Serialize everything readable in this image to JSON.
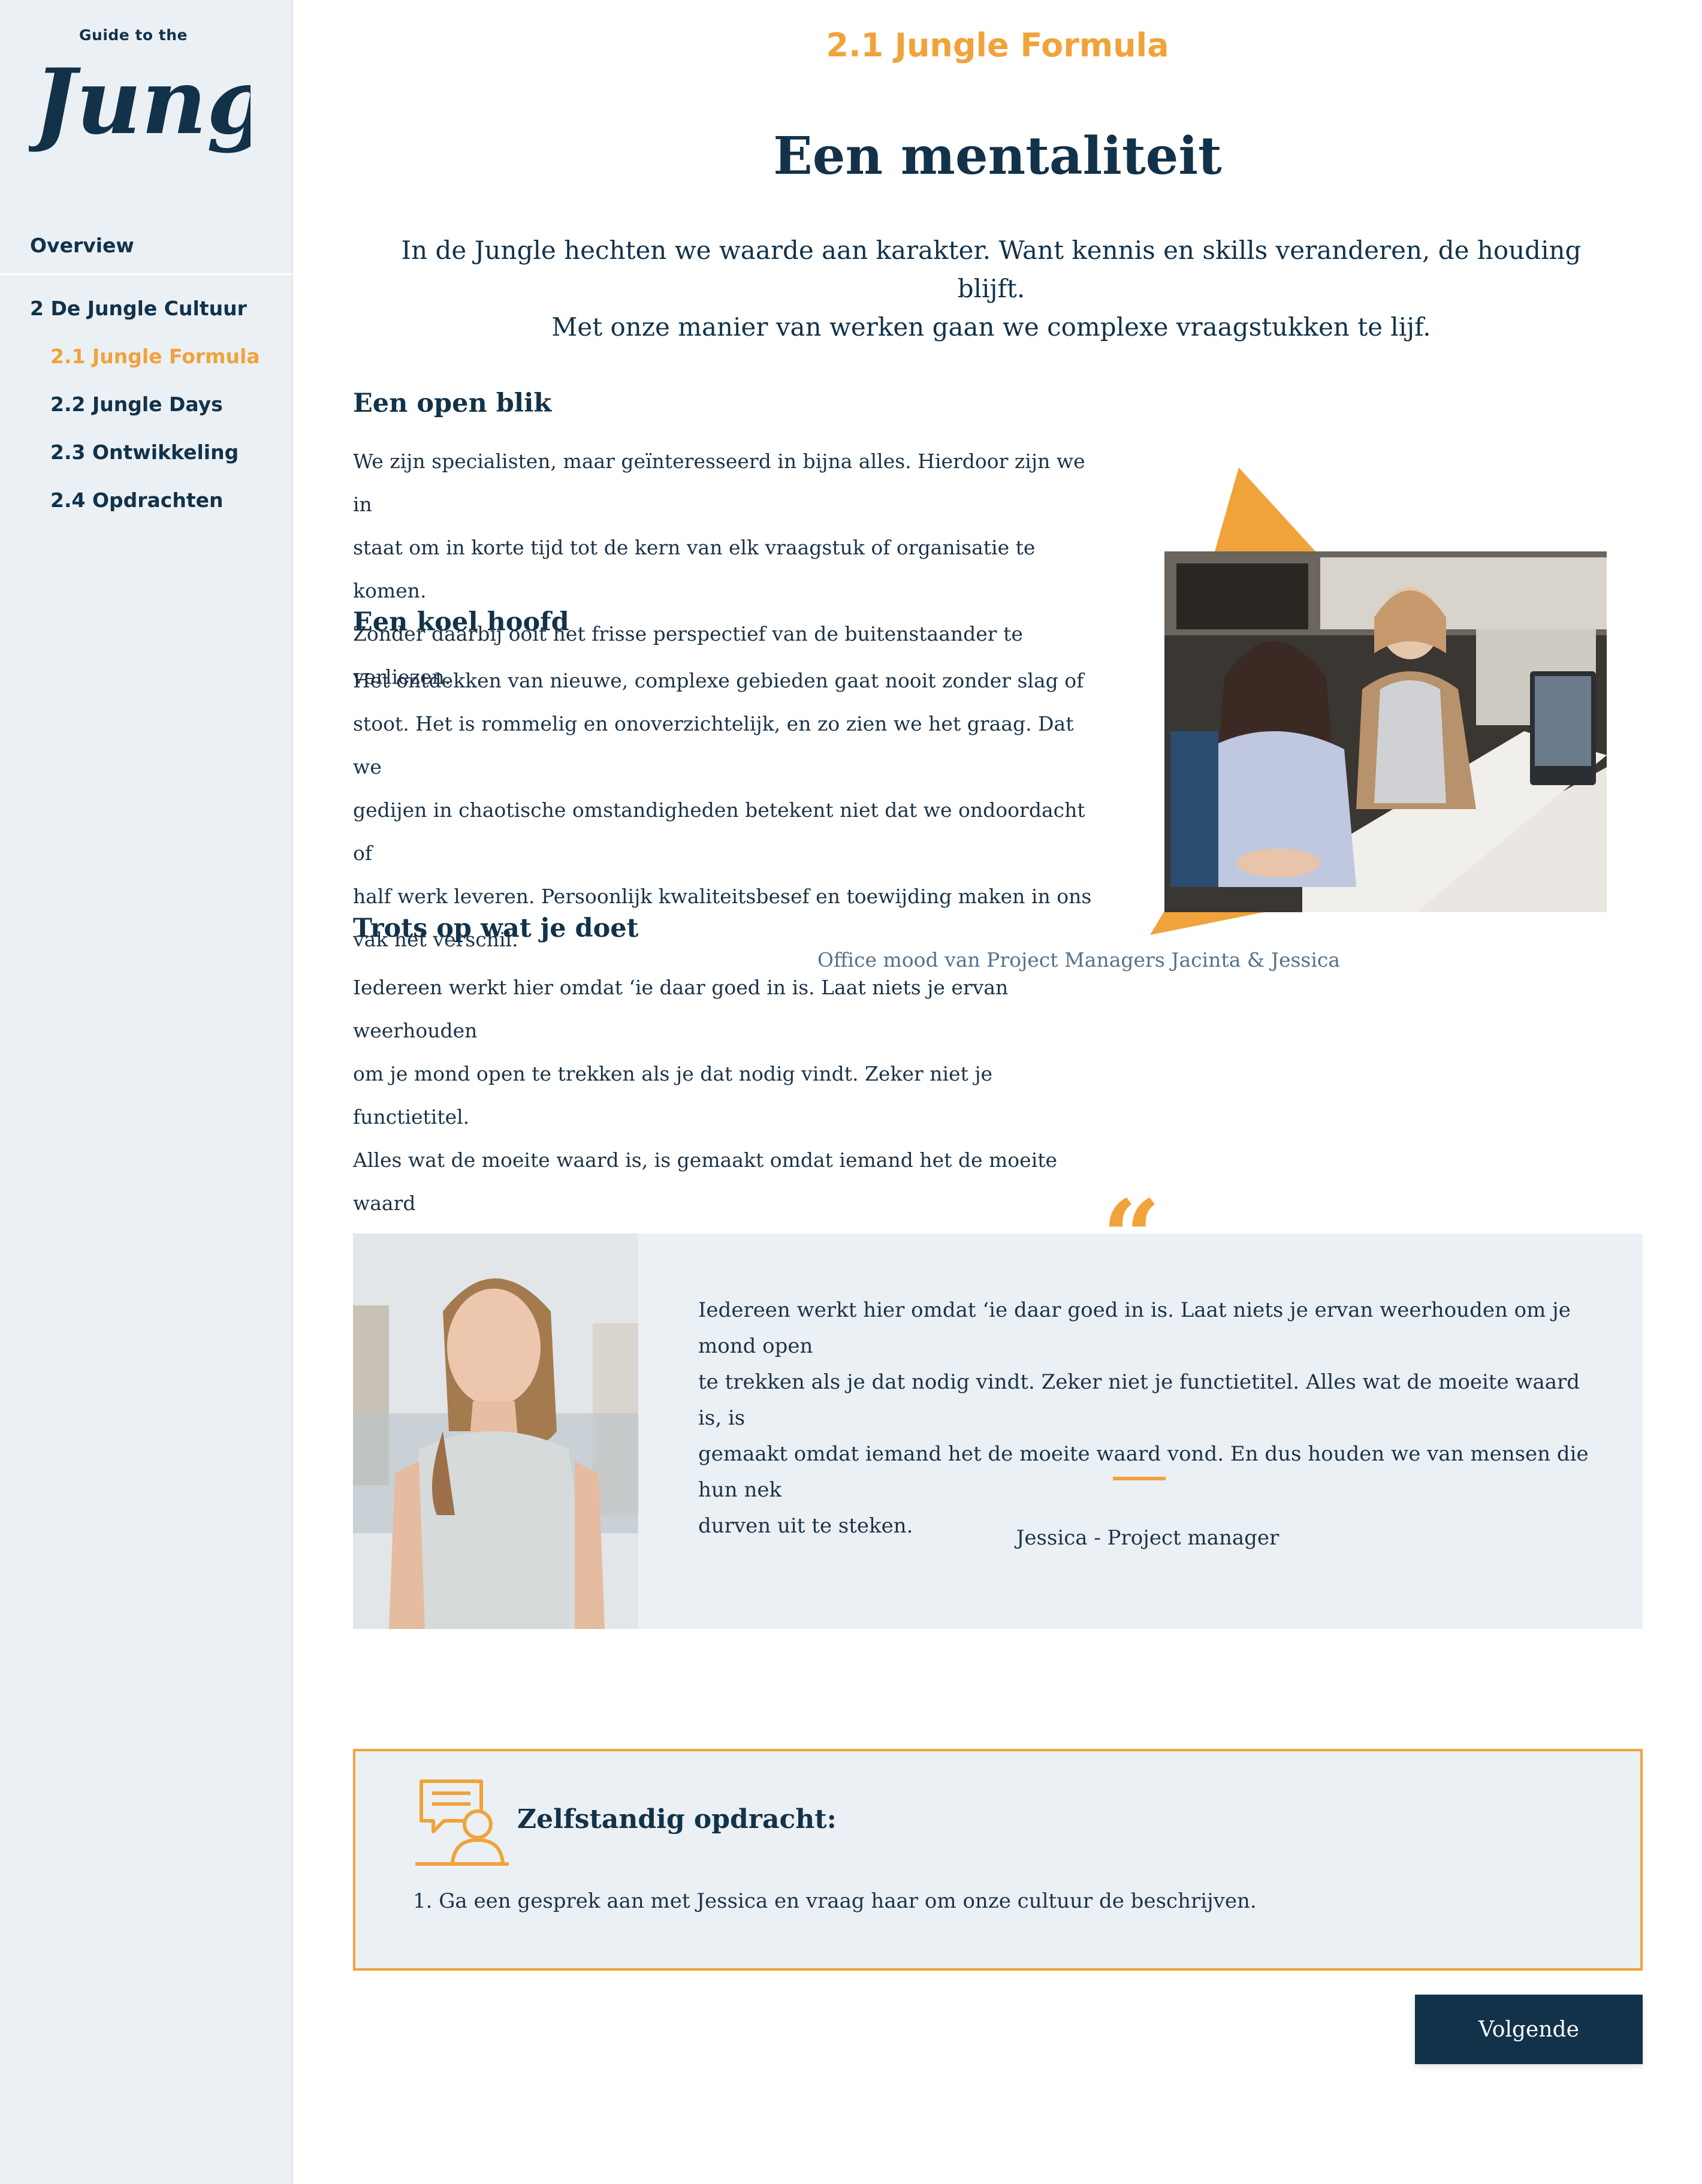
{
  "brand": {
    "logo_small": "Guide to the",
    "logo_main": "Jungle"
  },
  "sidebar": {
    "overview": "Overview",
    "chapter": "2 De Jungle Cultuur",
    "items": [
      {
        "label": "2.1 Jungle Formula",
        "active": true
      },
      {
        "label": "2.2 Jungle Days",
        "active": false
      },
      {
        "label": "2.3 Ontwikkeling",
        "active": false
      },
      {
        "label": "2.4 Opdrachten",
        "active": false
      }
    ]
  },
  "header": {
    "section": "2.1 Jungle Formula",
    "title": "Een mentaliteit",
    "intro_line1": "In de Jungle hechten we waarde aan karakter. Want kennis en skills veranderen, de houding blijft.",
    "intro_line2": "Met onze manier van werken gaan we complexe vraagstukken te lijf."
  },
  "sections": [
    {
      "heading": "Een open blik",
      "lines": [
        "We zijn specialisten, maar geïnteresseerd in bijna alles. Hierdoor zijn we in",
        "staat om in korte tijd tot de kern van elk vraagstuk of organisatie te komen.",
        "Zonder daarbij ooit het frisse perspectief van de buitenstaander te verliezen."
      ]
    },
    {
      "heading": "Een koel hoofd",
      "lines": [
        "Het ontdekken van nieuwe, complexe gebieden gaat nooit zonder slag of",
        "stoot. Het is rommelig en onoverzichtelijk, en zo zien we het graag. Dat we",
        "gedijen in chaotische omstandigheden betekent niet dat we ondoordacht of",
        "half werk leveren. Persoonlijk kwaliteitsbesef en toewijding maken in ons",
        "vak het verschil."
      ]
    },
    {
      "heading": "Trots op wat je doet",
      "lines": [
        "Iedereen werkt hier omdat ‘ie daar goed in is. Laat niets je ervan weerhouden",
        "om je mond open te trekken als je dat nodig vindt. Zeker niet je functietitel.",
        "Alles wat de moeite waard is, is gemaakt omdat iemand het de moeite waard",
        "vond. En dus houden we van mensen die hun nek durven uit te steken."
      ]
    }
  ],
  "photo": {
    "caption": "Office mood van Project Managers Jacinta & Jessica"
  },
  "quote": {
    "mark": "“",
    "lines": [
      "Iedereen werkt hier omdat ‘ie daar goed in is. Laat niets je ervan weerhouden om je mond open",
      "te trekken als je dat nodig vindt. Zeker niet je functietitel. Alles wat de moeite waard is, is",
      "gemaakt omdat iemand het de moeite waard vond. En dus houden we van mensen die hun nek",
      "durven uit te steken."
    ],
    "author": "Jessica - Project manager"
  },
  "task": {
    "title": "Zelfstandig opdracht:",
    "items": [
      "1. Ga een gesprek aan met Jessica en vraag haar om onze cultuur de beschrijven."
    ]
  },
  "next_button": "Volgende",
  "colors": {
    "accent": "#f0a33b",
    "navy": "#12324a",
    "panel": "#ebf0f4"
  }
}
